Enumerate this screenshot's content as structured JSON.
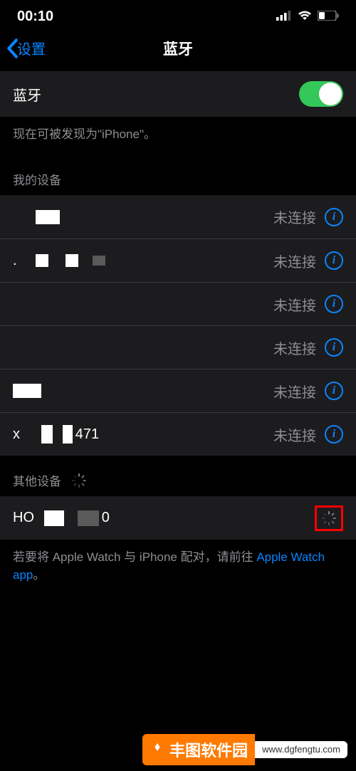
{
  "status": {
    "time": "00:10"
  },
  "nav": {
    "back": "设置",
    "title": "蓝牙"
  },
  "bluetooth": {
    "label": "蓝牙",
    "discoverable": "现在可被发现为\"iPhone\"。"
  },
  "mydevices": {
    "header": "我的设备",
    "status": "未连接",
    "items": [
      {
        "name_parts": [
          "",
          ""
        ]
      },
      {
        "name_parts": [
          ".",
          "",
          "",
          ""
        ]
      },
      {
        "name_parts": [
          ""
        ]
      },
      {
        "name_parts": [
          ""
        ]
      },
      {
        "name_parts": [
          ""
        ]
      },
      {
        "name_prefix": "x",
        "name_suffix": "471"
      }
    ]
  },
  "otherdevices": {
    "header": "其他设备",
    "items": [
      {
        "name_prefix": "HO",
        "name_suffix": "0"
      }
    ]
  },
  "footer": {
    "text_before": "若要将 Apple Watch 与 iPhone 配对，请前往 ",
    "link": "Apple Watch app",
    "text_after": "。"
  },
  "watermark": {
    "brand": "丰图软件园",
    "url": "www.dgfengtu.com"
  }
}
